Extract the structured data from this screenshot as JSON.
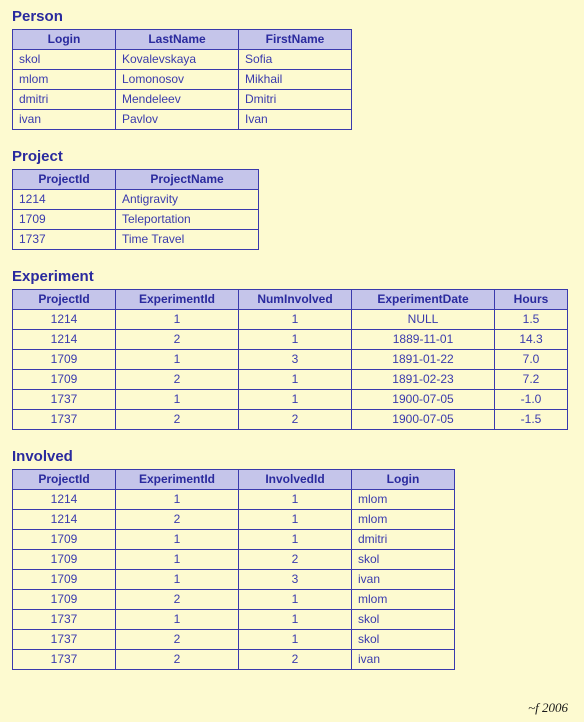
{
  "person": {
    "title": "Person",
    "columns": [
      "Login",
      "LastName",
      "FirstName"
    ],
    "rows": [
      [
        "skol",
        "Kovalevskaya",
        "Sofia"
      ],
      [
        "mlom",
        "Lomonosov",
        "Mikhail"
      ],
      [
        "dmitri",
        "Mendeleev",
        "Dmitri"
      ],
      [
        "ivan",
        "Pavlov",
        "Ivan"
      ]
    ]
  },
  "project": {
    "title": "Project",
    "columns": [
      "ProjectId",
      "ProjectName"
    ],
    "rows": [
      [
        "1214",
        "Antigravity"
      ],
      [
        "1709",
        "Teleportation"
      ],
      [
        "1737",
        "Time Travel"
      ]
    ]
  },
  "experiment": {
    "title": "Experiment",
    "columns": [
      "ProjectId",
      "ExperimentId",
      "NumInvolved",
      "ExperimentDate",
      "Hours"
    ],
    "rows": [
      [
        "1214",
        "1",
        "1",
        "NULL",
        "1.5"
      ],
      [
        "1214",
        "2",
        "1",
        "1889-11-01",
        "14.3"
      ],
      [
        "1709",
        "1",
        "3",
        "1891-01-22",
        "7.0"
      ],
      [
        "1709",
        "2",
        "1",
        "1891-02-23",
        "7.2"
      ],
      [
        "1737",
        "1",
        "1",
        "1900-07-05",
        "-1.0"
      ],
      [
        "1737",
        "2",
        "2",
        "1900-07-05",
        "-1.5"
      ]
    ]
  },
  "involved": {
    "title": "Involved",
    "columns": [
      "ProjectId",
      "ExperimentId",
      "InvolvedId",
      "Login"
    ],
    "rows": [
      [
        "1214",
        "1",
        "1",
        "mlom"
      ],
      [
        "1214",
        "2",
        "1",
        "mlom"
      ],
      [
        "1709",
        "1",
        "1",
        "dmitri"
      ],
      [
        "1709",
        "1",
        "2",
        "skol"
      ],
      [
        "1709",
        "1",
        "3",
        "ivan"
      ],
      [
        "1709",
        "2",
        "1",
        "mlom"
      ],
      [
        "1737",
        "1",
        "1",
        "skol"
      ],
      [
        "1737",
        "2",
        "1",
        "skol"
      ],
      [
        "1737",
        "2",
        "2",
        "ivan"
      ]
    ]
  },
  "signature": "~f 2006"
}
